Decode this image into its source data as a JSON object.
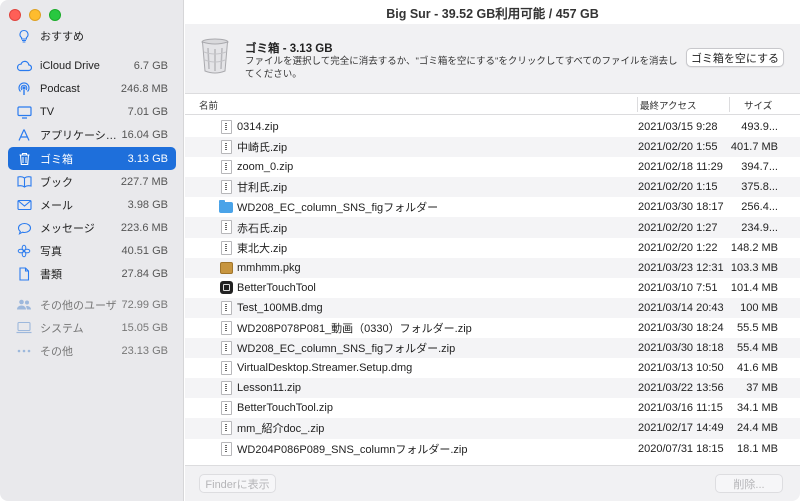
{
  "window": {
    "title": "Big Sur - 39.52 GB利用可能 / 457 GB"
  },
  "sidebar": {
    "items": [
      {
        "label": "おすすめ",
        "size": "",
        "icon": "lightbulb-icon",
        "selected": false,
        "dim": false
      },
      {
        "label": "iCloud Drive",
        "size": "6.7 GB",
        "icon": "cloud-icon",
        "selected": false,
        "dim": false
      },
      {
        "label": "Podcast",
        "size": "246.8 MB",
        "icon": "podcast-icon",
        "selected": false,
        "dim": false
      },
      {
        "label": "TV",
        "size": "7.01 GB",
        "icon": "tv-icon",
        "selected": false,
        "dim": false
      },
      {
        "label": "アプリケーシ…",
        "size": "16.04 GB",
        "icon": "applications-icon",
        "selected": false,
        "dim": false
      },
      {
        "label": "ゴミ箱",
        "size": "3.13 GB",
        "icon": "trash-icon",
        "selected": true,
        "dim": false
      },
      {
        "label": "ブック",
        "size": "227.7 MB",
        "icon": "book-icon",
        "selected": false,
        "dim": false
      },
      {
        "label": "メール",
        "size": "3.98 GB",
        "icon": "mail-icon",
        "selected": false,
        "dim": false
      },
      {
        "label": "メッセージ",
        "size": "223.6 MB",
        "icon": "message-icon",
        "selected": false,
        "dim": false
      },
      {
        "label": "写真",
        "size": "40.51 GB",
        "icon": "photos-icon",
        "selected": false,
        "dim": false
      },
      {
        "label": "書類",
        "size": "27.84 GB",
        "icon": "document-icon",
        "selected": false,
        "dim": false
      },
      {
        "label": "その他のユーザ",
        "size": "72.99 GB",
        "icon": "users-icon",
        "selected": false,
        "dim": true
      },
      {
        "label": "システム",
        "size": "15.05 GB",
        "icon": "system-icon",
        "selected": false,
        "dim": true
      },
      {
        "label": "その他",
        "size": "23.13 GB",
        "icon": "more-icon",
        "selected": false,
        "dim": true
      }
    ]
  },
  "header": {
    "title": "ゴミ箱 - 3.13 GB",
    "description": "ファイルを選択して完全に消去するか、\"ゴミ箱を空にする\"をクリックしてすべてのファイルを消去してください。",
    "empty_button": "ゴミ箱を空にする"
  },
  "table": {
    "columns": {
      "name": "名前",
      "date": "最終アクセス",
      "size": "サイズ"
    },
    "rows": [
      {
        "name": "0314.zip",
        "date": "2021/03/15 9:28",
        "size": "493.9...",
        "icon": "zip"
      },
      {
        "name": "中崎氏.zip",
        "date": "2021/02/20 1:55",
        "size": "401.7 MB",
        "icon": "zip"
      },
      {
        "name": "zoom_0.zip",
        "date": "2021/02/18 11:29",
        "size": "394.7...",
        "icon": "zip"
      },
      {
        "name": "甘利氏.zip",
        "date": "2021/02/20 1:15",
        "size": "375.8...",
        "icon": "zip"
      },
      {
        "name": "WD208_EC_column_SNS_figフォルダー",
        "date": "2021/03/30 18:17",
        "size": "256.4...",
        "icon": "folder"
      },
      {
        "name": "赤石氏.zip",
        "date": "2021/02/20 1:27",
        "size": "234.9...",
        "icon": "zip"
      },
      {
        "name": "東北大.zip",
        "date": "2021/02/20 1:22",
        "size": "148.2 MB",
        "icon": "zip"
      },
      {
        "name": "mmhmm.pkg",
        "date": "2021/03/23 12:31",
        "size": "103.3 MB",
        "icon": "pkg"
      },
      {
        "name": "BetterTouchTool",
        "date": "2021/03/10 7:51",
        "size": "101.4 MB",
        "icon": "app"
      },
      {
        "name": "Test_100MB.dmg",
        "date": "2021/03/14 20:43",
        "size": "100 MB",
        "icon": "zip"
      },
      {
        "name": "WD208P078P081_動画（0330）フォルダー.zip",
        "date": "2021/03/30 18:24",
        "size": "55.5 MB",
        "icon": "zip"
      },
      {
        "name": "WD208_EC_column_SNS_figフォルダー.zip",
        "date": "2021/03/30 18:18",
        "size": "55.4 MB",
        "icon": "zip"
      },
      {
        "name": "VirtualDesktop.Streamer.Setup.dmg",
        "date": "2021/03/13 10:50",
        "size": "41.6 MB",
        "icon": "zip"
      },
      {
        "name": "Lesson11.zip",
        "date": "2021/03/22 13:56",
        "size": "37 MB",
        "icon": "zip"
      },
      {
        "name": "BetterTouchTool.zip",
        "date": "2021/03/16 11:15",
        "size": "34.1 MB",
        "icon": "zip"
      },
      {
        "name": "mm_紹介doc_.zip",
        "date": "2021/02/17 14:49",
        "size": "24.4 MB",
        "icon": "zip"
      },
      {
        "name": "WD204P086P089_SNS_columnフォルダー.zip",
        "date": "2020/07/31 18:15",
        "size": "18.1 MB",
        "icon": "zip"
      }
    ]
  },
  "footer": {
    "finder_button": "Finderに表示",
    "delete_button": "削除..."
  },
  "colors": {
    "accent": "#1e6fdb",
    "sidebar_bg": "#e9e9ec"
  }
}
